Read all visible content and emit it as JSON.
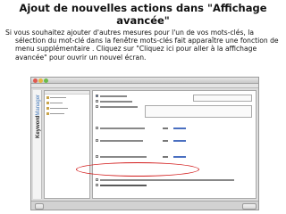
{
  "slide": {
    "title": "Ajout de nouvelles actions dans \"Affichage avancée\"",
    "body": "Si vous souhaitez ajouter d'autres mesures pour l'un de vos mots-clés, la sélection du mot-clé dans la fenêtre mots-clés fait apparaître une fonction de menu supplémentaire . Cliquez sur \"Cliquez ici pour aller à la affichage avancée\" pour ouvrir un nouvel écran."
  },
  "screenshot": {
    "brand_bold": "Keyword",
    "brand_light": "Manager"
  },
  "colors": {
    "highlight": "#d21a1a",
    "accent": "#3f6fc4"
  }
}
